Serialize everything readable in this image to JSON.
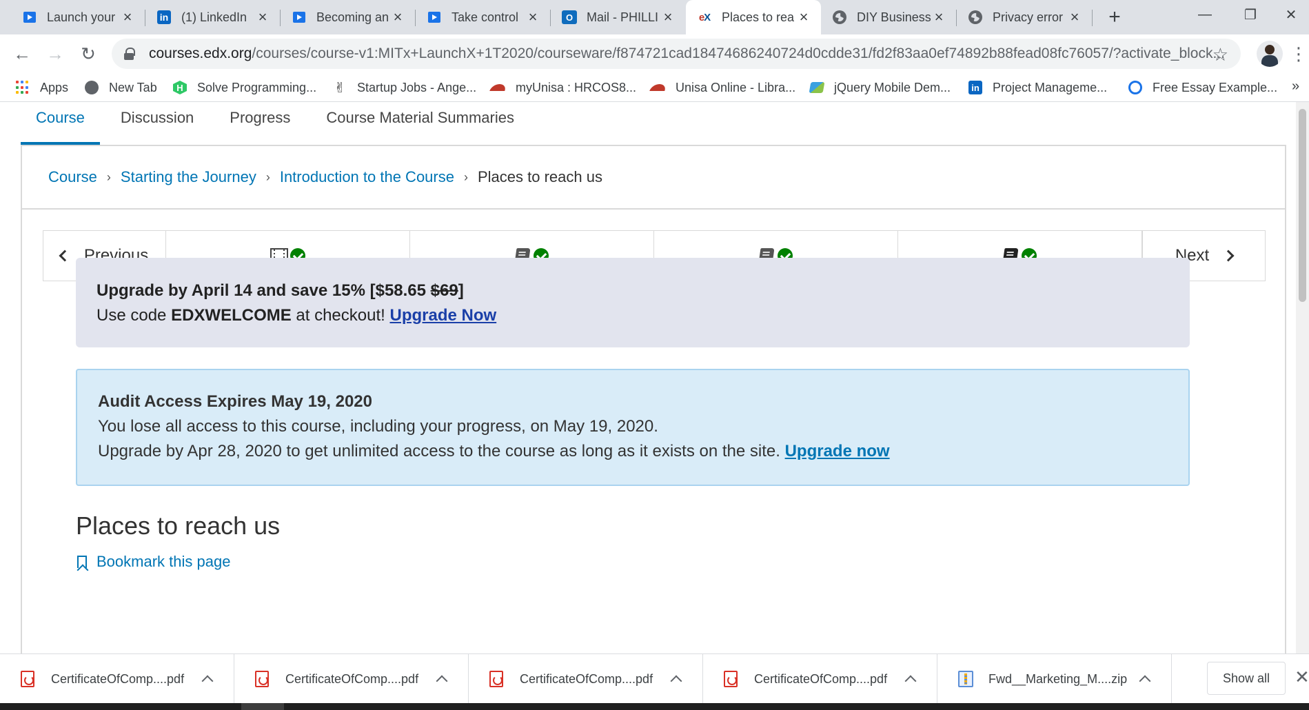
{
  "browser": {
    "tabs": [
      {
        "title": "Launch your",
        "icon": "play-icon"
      },
      {
        "title": "(1) LinkedIn",
        "icon": "linkedin-icon"
      },
      {
        "title": "Becoming an",
        "icon": "play-icon"
      },
      {
        "title": "Take control",
        "icon": "play-icon"
      },
      {
        "title": "Mail - PHILLI",
        "icon": "outlook-icon"
      },
      {
        "title": "Places to rea",
        "icon": "edx-icon",
        "active": true
      },
      {
        "title": "DIY Business",
        "icon": "globe-icon"
      },
      {
        "title": "Privacy error",
        "icon": "globe-icon"
      }
    ],
    "url_host": "courses.edx.org",
    "url_path": "/courses/course-v1:MITx+LaunchX+1T2020/courseware/f874721cad18474686240724d0cdde31/fd2f83aa0ef74892b88fead08fc76057/?activate_block...",
    "bookmarks": [
      {
        "label": "Apps",
        "icon": "apps-grid-icon"
      },
      {
        "label": "New Tab",
        "icon": "globe-icon"
      },
      {
        "label": "Solve Programming...",
        "icon": "hackerrank-icon"
      },
      {
        "label": "Startup Jobs - Ange...",
        "icon": "angellist-icon"
      },
      {
        "label": "myUnisa : HRCOS8...",
        "icon": "unisa-icon"
      },
      {
        "label": "Unisa Online - Libra...",
        "icon": "unisa-icon"
      },
      {
        "label": "jQuery Mobile Dem...",
        "icon": "jquery-icon"
      },
      {
        "label": "Project Manageme...",
        "icon": "linkedin-icon"
      },
      {
        "label": "Free Essay Example...",
        "icon": "essay-icon"
      }
    ],
    "bookmarks_more": "»"
  },
  "course": {
    "tabs": [
      {
        "label": "Course",
        "active": true
      },
      {
        "label": "Discussion"
      },
      {
        "label": "Progress"
      },
      {
        "label": "Course Material Summaries"
      }
    ],
    "breadcrumb": [
      {
        "label": "Course",
        "link": true
      },
      {
        "label": "Starting the Journey",
        "link": true
      },
      {
        "label": "Introduction to the Course",
        "link": true
      },
      {
        "label": "Places to reach us",
        "link": false
      }
    ],
    "sequence": {
      "previous_label": "Previous",
      "next_label": "Next",
      "items": [
        {
          "type": "video",
          "completed": true
        },
        {
          "type": "book",
          "completed": true
        },
        {
          "type": "book",
          "completed": true
        },
        {
          "type": "book",
          "completed": true,
          "active": true
        }
      ]
    },
    "upgrade_banner": {
      "title_prefix": "Upgrade by April 14 and save 15% [$58.65 ",
      "title_strike": "$69",
      "title_suffix": "]",
      "line2_prefix": "Use code ",
      "code": "EDXWELCOME",
      "line2_suffix": " at checkout! ",
      "link": "Upgrade Now"
    },
    "audit_banner": {
      "title": "Audit Access Expires May 19, 2020",
      "line1": "You lose all access to this course, including your progress, on May 19, 2020.",
      "line2": "Upgrade by Apr 28, 2020 to get unlimited access to the course as long as it exists on the site. ",
      "link": "Upgrade now"
    },
    "unit_title": "Places to reach us",
    "bookmark_label": "Bookmark this page"
  },
  "downloads": {
    "items": [
      {
        "name": "CertificateOfComp....pdf",
        "type": "pdf"
      },
      {
        "name": "CertificateOfComp....pdf",
        "type": "pdf"
      },
      {
        "name": "CertificateOfComp....pdf",
        "type": "pdf"
      },
      {
        "name": "CertificateOfComp....pdf",
        "type": "pdf"
      },
      {
        "name": "Fwd__Marketing_M....zip",
        "type": "zip"
      }
    ],
    "show_all": "Show all"
  },
  "colors": {
    "edx_link": "#0075b4",
    "upgrade_bg": "#e2e4ee",
    "audit_bg": "#d9ecf8",
    "complete_green": "#008100"
  }
}
